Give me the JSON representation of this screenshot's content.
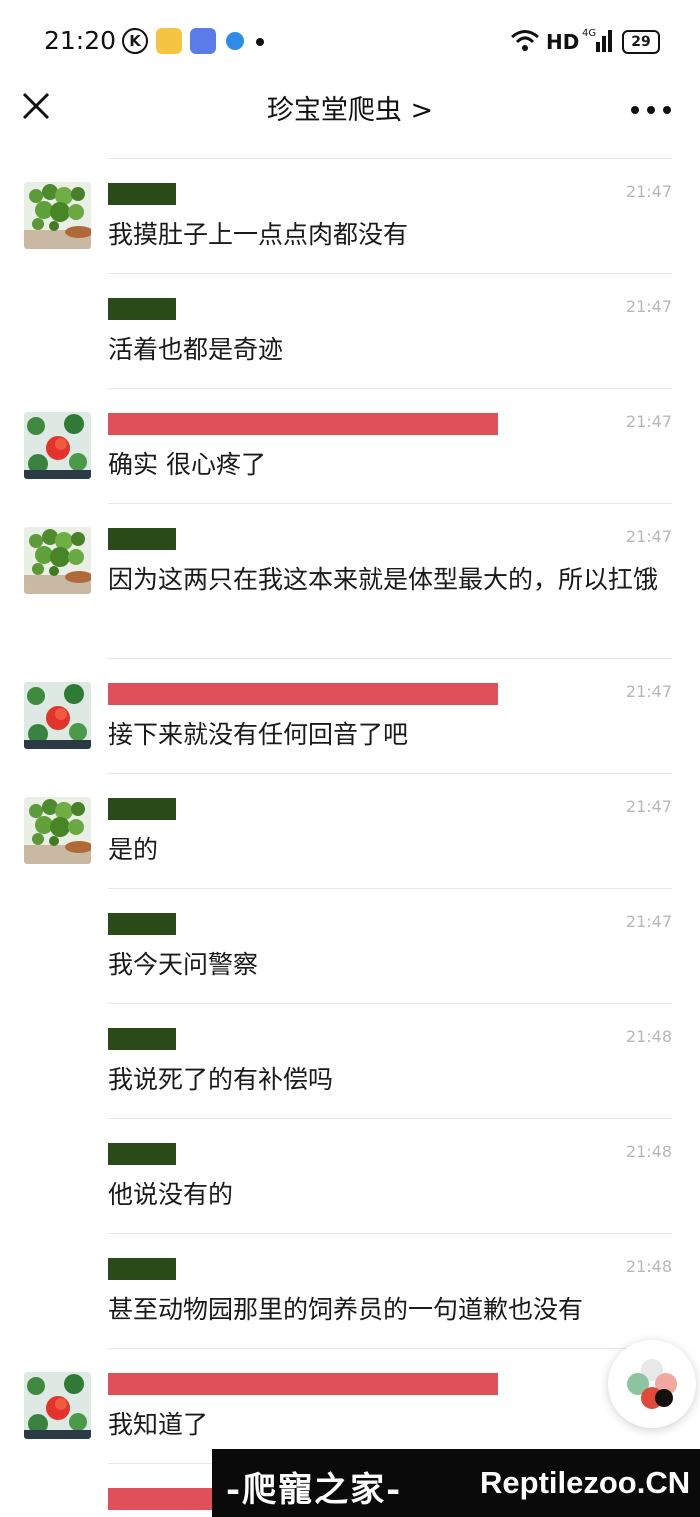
{
  "status_bar": {
    "time": "21:20",
    "k_badge": "K",
    "network": "HD",
    "signal_label": "4G",
    "battery": "29"
  },
  "header": {
    "title": "珍宝堂爬虫 >",
    "close_icon": "close-icon",
    "more_icon": "more-icon"
  },
  "messages": [
    {
      "avatar": "green-plant",
      "name_color": "dark",
      "time": "21:47",
      "text": "我摸肚子上一点点肉都没有"
    },
    {
      "avatar": "",
      "name_color": "dark",
      "time": "21:47",
      "text": "活着也都是奇迹"
    },
    {
      "avatar": "red-flower",
      "name_color": "red",
      "time": "21:47",
      "text": "确实 很心疼了"
    },
    {
      "avatar": "green-plant",
      "name_color": "dark",
      "time": "21:47",
      "text": "因为这两只在我这本来就是体型最大的，所以扛饿"
    },
    {
      "avatar": "red-flower",
      "name_color": "red",
      "time": "21:47",
      "text": "接下来就没有任何回音了吧"
    },
    {
      "avatar": "green-plant",
      "name_color": "dark",
      "time": "21:47",
      "text": "是的"
    },
    {
      "avatar": "",
      "name_color": "dark",
      "time": "21:47",
      "text": "我今天问警察"
    },
    {
      "avatar": "",
      "name_color": "dark",
      "time": "21:48",
      "text": "我说死了的有补偿吗"
    },
    {
      "avatar": "",
      "name_color": "dark",
      "time": "21:48",
      "text": "他说没有的"
    },
    {
      "avatar": "",
      "name_color": "dark",
      "time": "21:48",
      "text": "甚至动物园那里的饲养员的一句道歉也没有"
    },
    {
      "avatar": "red-flower",
      "name_color": "red",
      "time": "",
      "text": "我知道了"
    },
    {
      "avatar": "",
      "name_color": "red",
      "time": "",
      "text": ""
    }
  ],
  "watermark": {
    "cn": "-爬寵之家-",
    "en": "Reptilezoo.CN"
  },
  "colors": {
    "name_dark": "#2a4a18",
    "name_red": "#e0505a",
    "time_gray": "#b8b8b8"
  }
}
